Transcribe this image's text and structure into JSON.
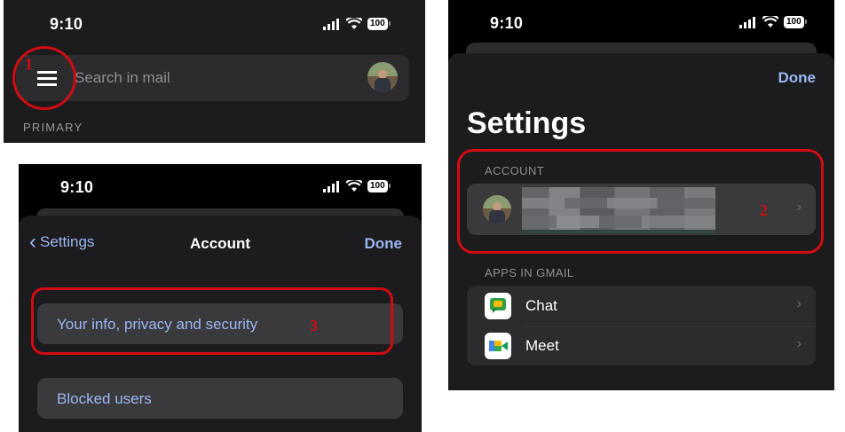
{
  "panel1": {
    "time": "9:10",
    "battery": "100",
    "search_placeholder": "Search in mail",
    "section_label": "PRIMARY",
    "step": "1"
  },
  "panel2": {
    "time": "9:10",
    "battery": "100",
    "back_label": "Settings",
    "title": "Account",
    "done_label": "Done",
    "items": [
      {
        "label": "Your info, privacy and security"
      },
      {
        "label": "Blocked users"
      }
    ],
    "step": "3"
  },
  "panel3": {
    "time": "9:10",
    "battery": "100",
    "done_label": "Done",
    "title": "Settings",
    "account_header": "ACCOUNT",
    "apps_header": "APPS IN GMAIL",
    "apps": [
      {
        "label": "Chat",
        "icon": "chat-icon"
      },
      {
        "label": "Meet",
        "icon": "meet-icon"
      }
    ],
    "step": "2"
  },
  "colors": {
    "link_blue": "#9bb6f2",
    "panel_dark": "#1c1c1e",
    "annotation_red": "#d10b12"
  }
}
